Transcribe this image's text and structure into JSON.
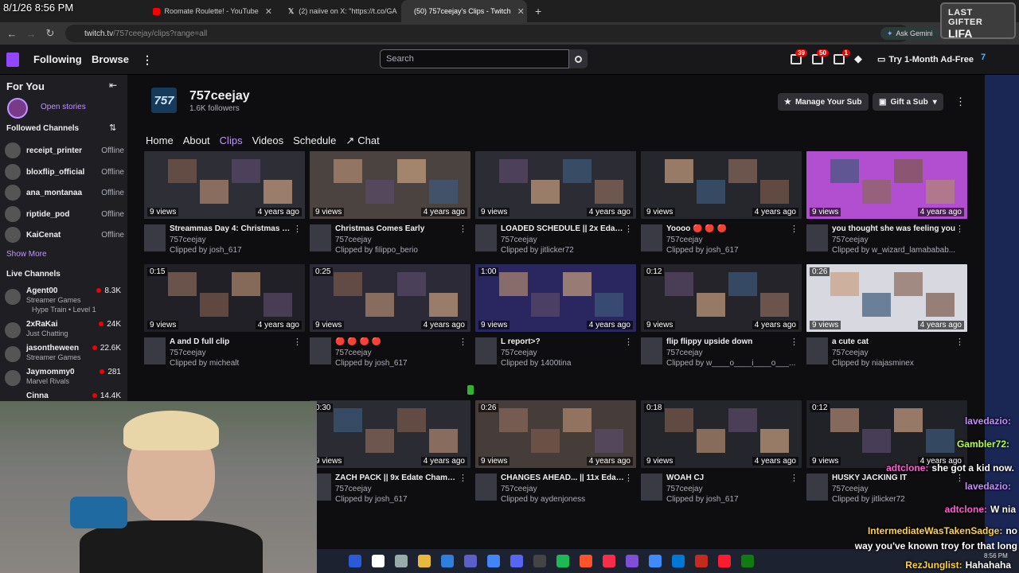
{
  "overlay_clock": "8/1/26 8:56 PM",
  "browser": {
    "tabs": [
      {
        "label": "Roomate Roulette! - YouTube",
        "color": "#ff0000"
      },
      {
        "label": "(2) naiive on X: \"https://t.co/GA",
        "color": "#dddddd"
      },
      {
        "label": "(50) 757ceejay's Clips - Twitch",
        "color": "#9147ff"
      }
    ],
    "new_tab": "+",
    "url_host": "twitch.tv",
    "url_path": "/757ceejay/clips?range=all",
    "gemini_label": "Ask Gemini"
  },
  "gifter_overlay": {
    "line1": "LAST GIFTER",
    "line2": "LIFA"
  },
  "topnav": {
    "following": "Following",
    "browse": "Browse",
    "search_placeholder": "Search",
    "badges": [
      "39",
      "50",
      "1"
    ],
    "ad_free": "Try 1-Month Ad-Free"
  },
  "sidebar": {
    "for_you": "For You",
    "open_stories": "Open stories",
    "followed_header": "Followed Channels",
    "followed": [
      {
        "name": "receipt_printer",
        "status": "Offline"
      },
      {
        "name": "bloxflip_official",
        "status": "Offline"
      },
      {
        "name": "ana_montanaa",
        "status": "Offline"
      },
      {
        "name": "riptide_pod",
        "status": "Offline"
      },
      {
        "name": "KaiCenat",
        "status": "Offline"
      }
    ],
    "show_more": "Show More",
    "live_header": "Live Channels",
    "live": [
      {
        "name": "Agent00",
        "game": "Streamer Games",
        "extra": "Hype Train • Level 1",
        "viewers": "8.3K"
      },
      {
        "name": "2xRaKai",
        "game": "Just Chatting",
        "viewers": "24K"
      },
      {
        "name": "jasontheween",
        "game": "Streamer Games",
        "viewers": "22.6K"
      },
      {
        "name": "Jaymommy0",
        "game": "Marvel Rivals",
        "viewers": "281"
      },
      {
        "name": "Cinna",
        "game": "",
        "viewers": "14.4K"
      }
    ]
  },
  "channel": {
    "logo_text": "757",
    "name": "757ceejay",
    "followers": "1.6K followers",
    "manage_sub": "Manage Your Sub",
    "gift_sub": "Gift a Sub",
    "tabs": [
      "Home",
      "About",
      "Clips",
      "Videos",
      "Schedule",
      "Chat"
    ],
    "active_tab": "Clips"
  },
  "clips": [
    {
      "title": "Streammas Day 4: Christmas Ca...",
      "channel": "757ceejay",
      "by": "Clipped by josh_617",
      "duration": "",
      "views": "9 views",
      "age": "4 years ago",
      "bg": "#2e2e36"
    },
    {
      "title": "Christmas Comes Early",
      "channel": "757ceejay",
      "by": "Clipped by filippo_berio",
      "duration": "",
      "views": "9 views",
      "age": "4 years ago",
      "bg": "#4a4340"
    },
    {
      "title": "LOADED SCHEDULE || 2x Edate ...",
      "channel": "757ceejay",
      "by": "Clipped by jitlicker72",
      "duration": "",
      "views": "9 views",
      "age": "4 years ago",
      "bg": "#2c2c34"
    },
    {
      "title": "Yoooo 🔴 🔴 🔴",
      "channel": "757ceejay",
      "by": "Clipped by josh_617",
      "duration": "",
      "views": "9 views",
      "age": "4 years ago",
      "bg": "#26262d"
    },
    {
      "title": "you thought she was feeling you",
      "channel": "757ceejay",
      "by": "Clipped by w_wizard_lamababab...",
      "duration": "",
      "views": "9 views",
      "age": "4 years ago",
      "bg": "#b24fd0"
    },
    {
      "title": "A and D full clip",
      "channel": "757ceejay",
      "by": "Clipped by michealt",
      "duration": "0:15",
      "views": "9 views",
      "age": "4 years ago",
      "bg": "#202026"
    },
    {
      "title": "🔴 🔴 🔴 🔴",
      "channel": "757ceejay",
      "by": "Clipped by josh_617",
      "duration": "0:25",
      "views": "9 views",
      "age": "4 years ago",
      "bg": "#2b2a36"
    },
    {
      "title": "L report>?",
      "channel": "757ceejay",
      "by": "Clipped by 1400tina",
      "duration": "1:00",
      "views": "9 views",
      "age": "4 years ago",
      "bg": "#2a2660"
    },
    {
      "title": "flip flippy upside down",
      "channel": "757ceejay",
      "by": "Clipped by w____o____i____o___...",
      "duration": "0:12",
      "views": "9 views",
      "age": "4 years ago",
      "bg": "#24242a"
    },
    {
      "title": "a cute cat",
      "channel": "757ceejay",
      "by": "Clipped by niajasminex",
      "duration": "0:26",
      "views": "9 views",
      "age": "4 years ago",
      "bg": "#d8d8e0"
    },
    {
      "title": "ZACH PACK || 9x Edate Champi...",
      "channel": "757ceejay",
      "by": "Clipped by josh_617",
      "duration": "0:30",
      "views": "9 views",
      "age": "4 years ago",
      "bg": "#2b2b34"
    },
    {
      "title": "CHANGES AHEAD... || 11x Edate ...",
      "channel": "757ceejay",
      "by": "Clipped by aydenjoness",
      "duration": "0:26",
      "views": "9 views",
      "age": "4 years ago",
      "bg": "#463c3a"
    },
    {
      "title": "WOAH CJ",
      "channel": "757ceejay",
      "by": "Clipped by josh_617",
      "duration": "0:18",
      "views": "9 views",
      "age": "4 years ago",
      "bg": "#25252c"
    },
    {
      "title": "HUSKY JACKING IT",
      "channel": "757ceejay",
      "by": "Clipped by jitlicker72",
      "duration": "0:12",
      "views": "9 views",
      "age": "4 years ago",
      "bg": "#212128"
    }
  ],
  "stream_chat": [
    {
      "user": "lavedazio:",
      "msg": "",
      "color": "#c58bff"
    },
    {
      "user": "Gambler72:",
      "msg": "",
      "color": "#b6ff4d"
    },
    {
      "user": "adtclone:",
      "msg": "she got a kid now.",
      "color": "#ff5fd2"
    },
    {
      "user": "lavedazio:",
      "msg": "",
      "color": "#c58bff"
    },
    {
      "user": "adtclone:",
      "msg": "W nia",
      "color": "#ff5fd2"
    },
    {
      "user": "IntermediateWasTakenSadge:",
      "msg": "no",
      "color": "#ffd23f"
    },
    {
      "user": "",
      "msg": "way you've known troy for that long",
      "color": "#ffd23f"
    },
    {
      "user": "RezJunglist:",
      "msg": "Hahahaha",
      "color": "#ffd23f"
    }
  ],
  "taskbar": {
    "icons": [
      "start-icon",
      "search-icon",
      "taskview-icon",
      "folder-icon",
      "vscode-icon",
      "teams-icon",
      "chrome-icon",
      "discord-icon",
      "obs-icon",
      "spotify-icon",
      "brave-icon",
      "music-icon",
      "app-icon",
      "help-icon",
      "store-icon",
      "mail-icon",
      "opera-icon",
      "xbox-icon"
    ],
    "colors": [
      "#2a5bd7",
      "#ffffff",
      "#9aa",
      "#e8b93a",
      "#2f7fdc",
      "#5b5fc7",
      "#4285f4",
      "#5865f2",
      "#444",
      "#1db954",
      "#fb542b",
      "#fa2d48",
      "#7f4fd8",
      "#3d8bfd",
      "#0078d4",
      "#c42b1c",
      "#ff1b2d",
      "#107c10"
    ],
    "time": "8:56 PM"
  }
}
